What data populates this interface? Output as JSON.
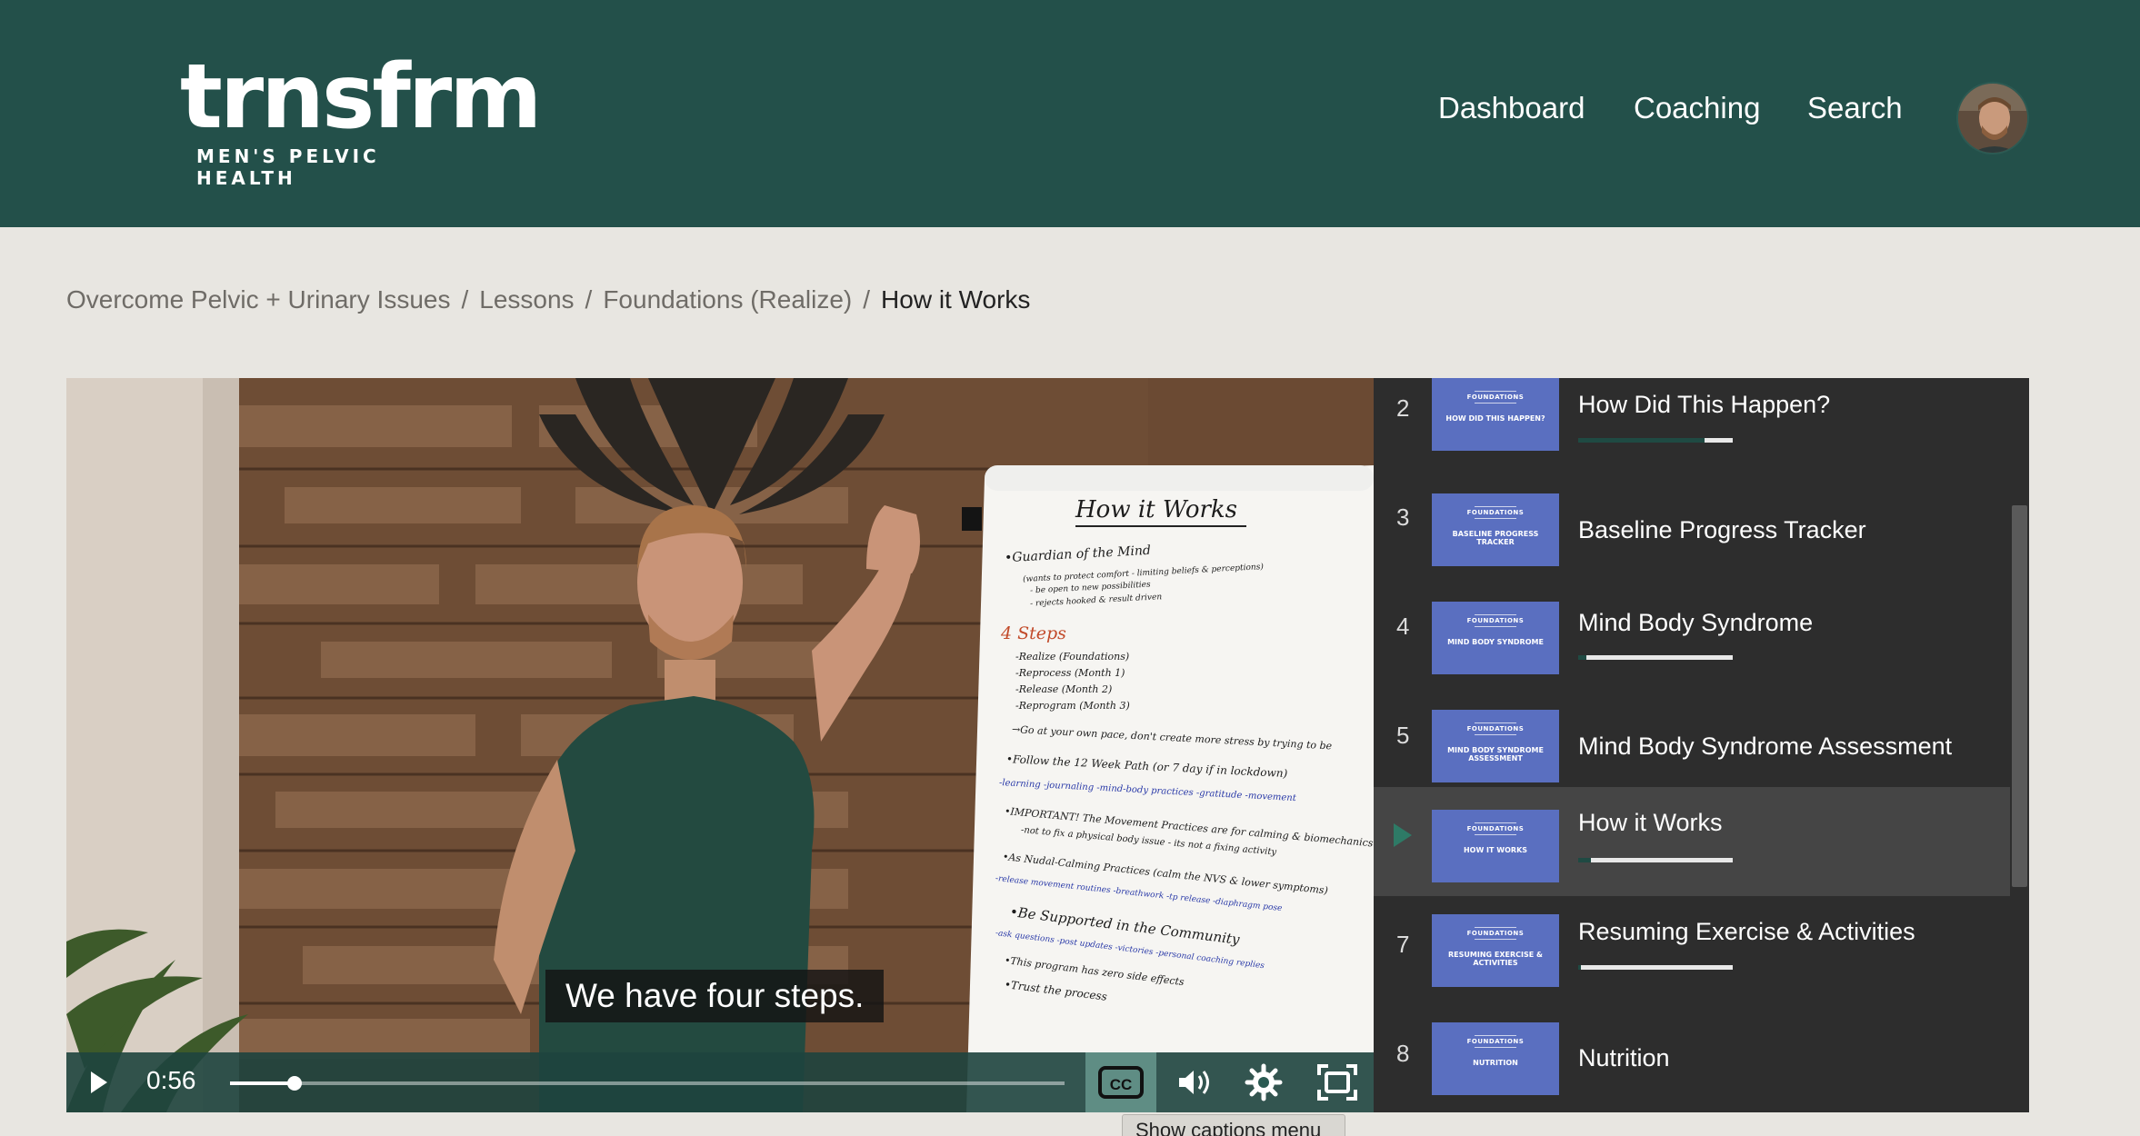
{
  "header": {
    "logo": {
      "word": "trnsfrm",
      "sub": "MEN'S PELVIC HEALTH"
    },
    "nav": [
      "Dashboard",
      "Coaching",
      "Search"
    ]
  },
  "breadcrumb": {
    "items": [
      "Overcome Pelvic + Urinary Issues",
      "Lessons",
      "Foundations (Realize)"
    ],
    "separator": "/",
    "current": "How it Works"
  },
  "player": {
    "caption": "We have four steps.",
    "time": "0:56",
    "progress": 0.077,
    "cc_label": "CC",
    "tooltip": "Show captions menu",
    "whiteboard": {
      "title": "How it Works",
      "notes": [
        "•Guardian of the Mind",
        "(wants to protect comfort - limiting beliefs & perceptions)",
        "- be open to new possibilities",
        "- rejects hooked & result driven",
        "4 Steps",
        "-Realize (Foundations)",
        "-Reprocess (Month 1)",
        "-Release (Month 2)",
        "-Reprogram (Month 3)",
        "→Go at your own pace, don't create more stress by trying to be",
        "•Follow the 12 Week Path (or 7 day if in lockdown)",
        "-learning  -journaling  -mind-body practices  -gratitude  -movement",
        "•IMPORTANT! The Movement Practices are for calming & biomechanics",
        "-not to fix a physical body issue - its not a fixing activity",
        "•As Nudal-Calming Practices (calm the NVS & lower symptoms)",
        "-release movement routines  -breathwork  -tp release  -diaphragm pose",
        "•Be Supported in the Community",
        "-ask questions  -post updates  -victories  -personal coaching replies",
        "•This program has zero side effects",
        "•Trust the process"
      ]
    }
  },
  "playlist": {
    "items": [
      {
        "num": "2",
        "title": "How Did This Happen?",
        "thumb_top": "FOUNDATIONS",
        "thumb": "HOW DID THIS HAPPEN?",
        "progress": 0.82,
        "active": false
      },
      {
        "num": "3",
        "title": "Baseline Progress Tracker",
        "thumb_top": "FOUNDATIONS",
        "thumb": "BASELINE PROGRESS TRACKER",
        "progress": null,
        "active": false
      },
      {
        "num": "4",
        "title": "Mind Body Syndrome",
        "thumb_top": "FOUNDATIONS",
        "thumb": "MIND BODY SYNDROME",
        "progress": 0.05,
        "active": false
      },
      {
        "num": "5",
        "title": "Mind Body Syndrome Assessment",
        "thumb_top": "FOUNDATIONS",
        "thumb": "MIND BODY SYNDROME ASSESSMENT",
        "progress": null,
        "active": false
      },
      {
        "num": "",
        "title": "How it Works",
        "thumb_top": "FOUNDATIONS",
        "thumb": "HOW IT WORKS",
        "progress": 0.08,
        "active": true
      },
      {
        "num": "7",
        "title": "Resuming Exercise & Activities",
        "thumb_top": "FOUNDATIONS",
        "thumb": "RESUMING EXERCISE & ACTIVITIES",
        "progress": 0.02,
        "active": false
      },
      {
        "num": "8",
        "title": "Nutrition",
        "thumb_top": "FOUNDATIONS",
        "thumb": "NUTRITION",
        "progress": null,
        "active": false
      }
    ]
  },
  "colors": {
    "header_bg": "#23504a",
    "page_bg": "#e8e6e1",
    "playlist_bg": "#2d2d2d",
    "thumb_bg": "#5a6fc0",
    "accent": "#2e7a66"
  }
}
